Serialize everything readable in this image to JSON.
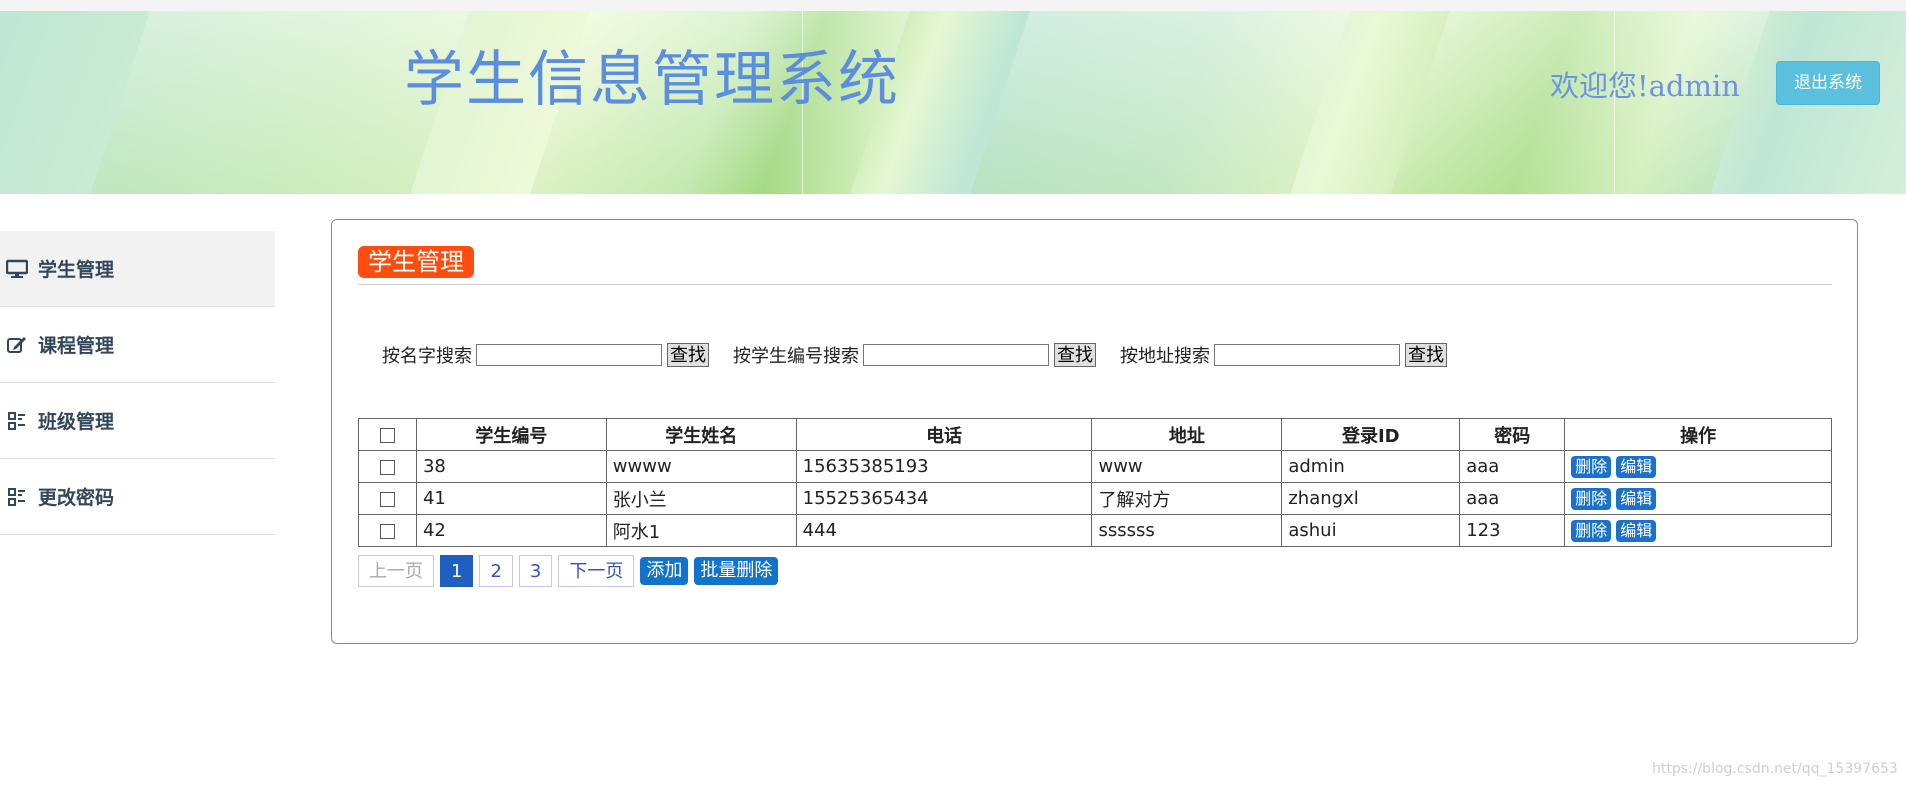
{
  "header": {
    "title": "学生信息管理系统",
    "welcome": "欢迎您!admin",
    "logout_label": "退出系统"
  },
  "sidebar": {
    "items": [
      {
        "label": "学生管理",
        "icon": "monitor-icon"
      },
      {
        "label": "课程管理",
        "icon": "edit-icon"
      },
      {
        "label": "班级管理",
        "icon": "grid-icon"
      },
      {
        "label": "更改密码",
        "icon": "grid-icon"
      }
    ]
  },
  "main": {
    "section_title": "学生管理",
    "search": {
      "by_name_label": "按名字搜索",
      "by_id_label": "按学生编号搜索",
      "by_address_label": "按地址搜索",
      "find_label": "查找",
      "name_value": "",
      "id_value": "",
      "address_value": ""
    },
    "table": {
      "columns": [
        "学生编号",
        "学生姓名",
        "电话",
        "地址",
        "登录ID",
        "密码",
        "操作"
      ],
      "rows": [
        {
          "id": "38",
          "name": "wwww",
          "phone": "15635385193",
          "address": "www",
          "login": "admin",
          "password": "aaa"
        },
        {
          "id": "41",
          "name": "张小兰",
          "phone": "15525365434",
          "address": "了解对方",
          "login": "zhangxl",
          "password": "aaa"
        },
        {
          "id": "42",
          "name": "阿水1",
          "phone": "444",
          "address": "ssssss",
          "login": "ashui",
          "password": "123"
        }
      ],
      "delete_label": "删除",
      "edit_label": "编辑"
    },
    "pager": {
      "prev": "上一页",
      "pages": [
        "1",
        "2",
        "3"
      ],
      "current": "1",
      "next": "下一页",
      "add": "添加",
      "batch_delete": "批量删除"
    }
  },
  "watermark": "https://blog.csdn.net/qq_15397653",
  "colors": {
    "accent": "#1173c9",
    "section_badge": "#ff4c0f",
    "logout": "#5bc0de",
    "title": "#5b8ede"
  }
}
